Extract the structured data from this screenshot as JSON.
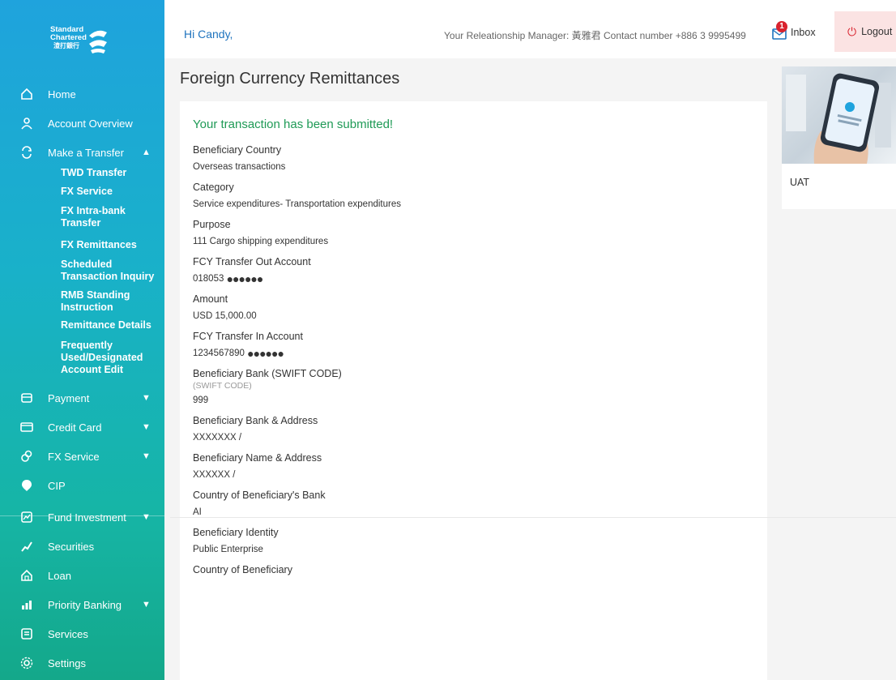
{
  "brand": {
    "line1": "Standard",
    "line2": "Chartered",
    "line3": "渣打銀行"
  },
  "header": {
    "greeting": "Hi Candy,",
    "rm_text": "Your Releationship Manager: 黃雅君 Contact number +886 3 9995499",
    "inbox_label": "Inbox",
    "inbox_count": "1",
    "logout_label": "Logout"
  },
  "sidebar": {
    "items": [
      {
        "label": "Home",
        "icon": "home-icon"
      },
      {
        "label": "Account Overview",
        "icon": "user-icon"
      },
      {
        "label": "Make a Transfer",
        "icon": "transfer-icon",
        "expanded": true
      },
      {
        "label": "Payment",
        "icon": "wallet-icon"
      },
      {
        "label": "Credit Card",
        "icon": "credit-card-icon"
      },
      {
        "label": "FX Service",
        "icon": "fx-icon"
      },
      {
        "label": "CIP",
        "icon": "cip-icon"
      },
      {
        "label": "Fund Investment",
        "icon": "fund-icon"
      },
      {
        "label": "Securities",
        "icon": "securities-icon"
      },
      {
        "label": "Loan",
        "icon": "loan-icon"
      },
      {
        "label": "Priority Banking",
        "icon": "priority-icon"
      },
      {
        "label": "Services",
        "icon": "services-icon"
      },
      {
        "label": "Settings",
        "icon": "settings-icon"
      }
    ],
    "transfer_sub": [
      "TWD Transfer",
      "FX Service",
      "FX Intra-bank Transfer",
      "FX Remittances",
      "Scheduled Transaction Inquiry",
      "RMB Standing Instruction",
      "Remittance Details",
      "Frequently Used/Designated Account Edit"
    ]
  },
  "main": {
    "title": "Foreign Currency Remittances",
    "success": "Your transaction has been submitted!",
    "fields": [
      {
        "label": "Beneficiary Country",
        "value": "Overseas transactions"
      },
      {
        "label": "Category",
        "value": "Service expenditures- Transportation expenditures"
      },
      {
        "label": "Purpose",
        "value": "111 Cargo shipping expenditures"
      },
      {
        "label": "FCY Transfer Out Account",
        "value": "018053",
        "masked": "●●●●●●"
      },
      {
        "label": "Amount",
        "value": "USD 15,000.00"
      },
      {
        "label": "FCY Transfer In Account",
        "value": "1234567890",
        "masked": "●●●●●●"
      },
      {
        "label": "Beneficiary Bank (SWIFT CODE)",
        "sub": "(SWIFT CODE)",
        "value": "999"
      },
      {
        "label": "Beneficiary Bank & Address",
        "value": "XXXXXXX /"
      },
      {
        "label": "Beneficiary Name & Address",
        "value": "XXXXXX /"
      },
      {
        "label": "Country of Beneficiary's Bank",
        "value": "AI"
      },
      {
        "label": "Beneficiary Identity",
        "value": "Public Enterprise"
      },
      {
        "label": "Country of Beneficiary",
        "value": ""
      }
    ]
  },
  "promo": {
    "label": "UAT"
  },
  "colors": {
    "accent_blue": "#1e73be",
    "success_green": "#1f9a56",
    "logout_bg": "#fbe3e3",
    "badge_red": "#d9232e"
  }
}
